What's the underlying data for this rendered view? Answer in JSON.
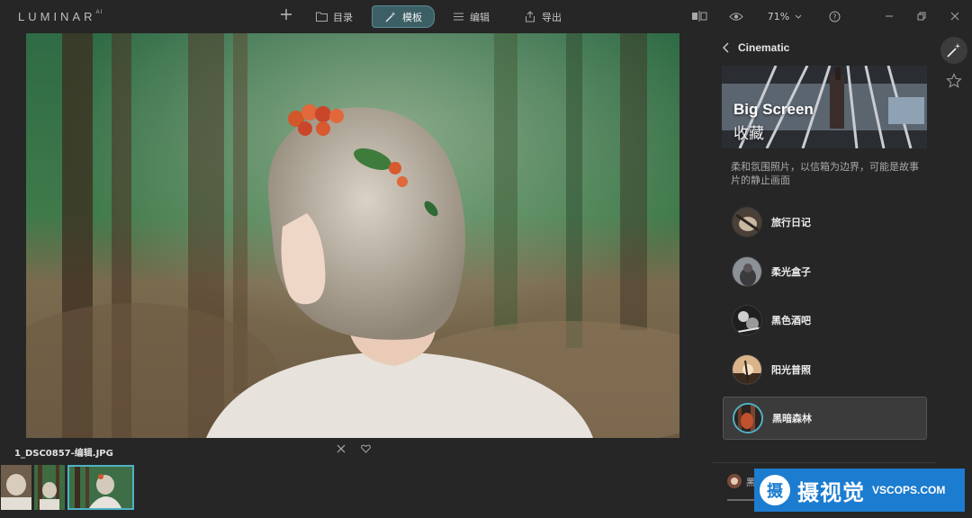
{
  "app": {
    "logo": "LUMINAR",
    "logo_suffix": "AI"
  },
  "toolbar": {
    "add_icon": "plus-icon",
    "tabs": [
      {
        "label": "目录",
        "icon": "folder-icon"
      },
      {
        "label": "模板",
        "icon": "magic-wand-icon"
      },
      {
        "label": "编辑",
        "icon": "sliders-icon"
      },
      {
        "label": "导出",
        "icon": "share-icon"
      }
    ],
    "zoom_label": "71%"
  },
  "filmstrip": {
    "filename": "1_DSC0857-编辑.JPG"
  },
  "panel": {
    "title": "Cinematic",
    "hero_title": "Big Screen",
    "hero_subtitle": "收藏",
    "description": "柔和氛围照片，以信箱为边界，可能是故事片的静止画面",
    "presets": [
      {
        "label": "旅行日记"
      },
      {
        "label": "柔光盒子"
      },
      {
        "label": "黑色酒吧"
      },
      {
        "label": "阳光普照"
      },
      {
        "label": "黑暗森林"
      }
    ],
    "bottom_label": "黑"
  },
  "watermark": {
    "badge": "摄",
    "text": "摄视觉",
    "domain": "VSCOPS.COM"
  },
  "colors": {
    "background": "#262626",
    "accent": "#4fb2c4",
    "active_tab": "#3c5f65",
    "watermark": "#1c7ccf"
  }
}
